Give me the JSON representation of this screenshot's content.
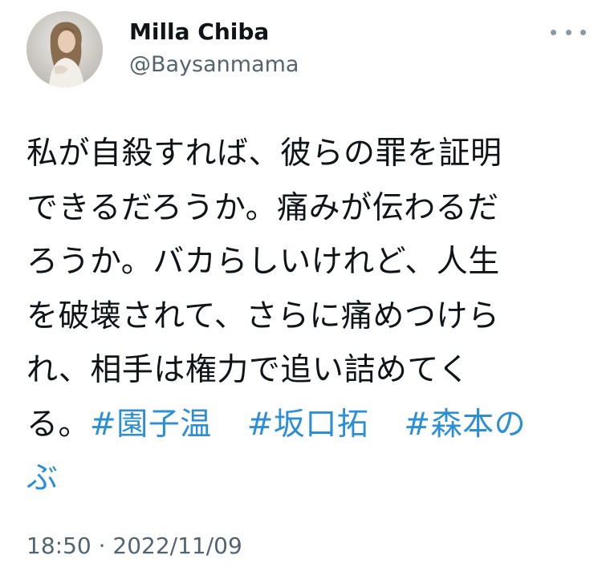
{
  "author": {
    "display_name": "Milla Chiba",
    "handle": "@Baysanmama"
  },
  "more_icon": "more-horizontal-icon",
  "tweet": {
    "lines": {
      "l1": "私が自殺すれば、彼らの罪を証明",
      "l2": "できるだろうか。痛みが伝わるだ",
      "l3": "ろうか。バカらしいけれど、人生",
      "l4": "を破壊されて、さらに痛めつけら",
      "l5": "れ、相手は権力で追い詰めてく",
      "l6": "る。"
    },
    "hashtags": [
      "#園子温",
      "#坂口拓",
      "#森本の",
      "ぶ"
    ]
  },
  "timestamp": "18:50 · 2022/11/09",
  "colors": {
    "text": "#0f1419",
    "secondary": "#536471",
    "hashtag": "#2b8fd6"
  }
}
